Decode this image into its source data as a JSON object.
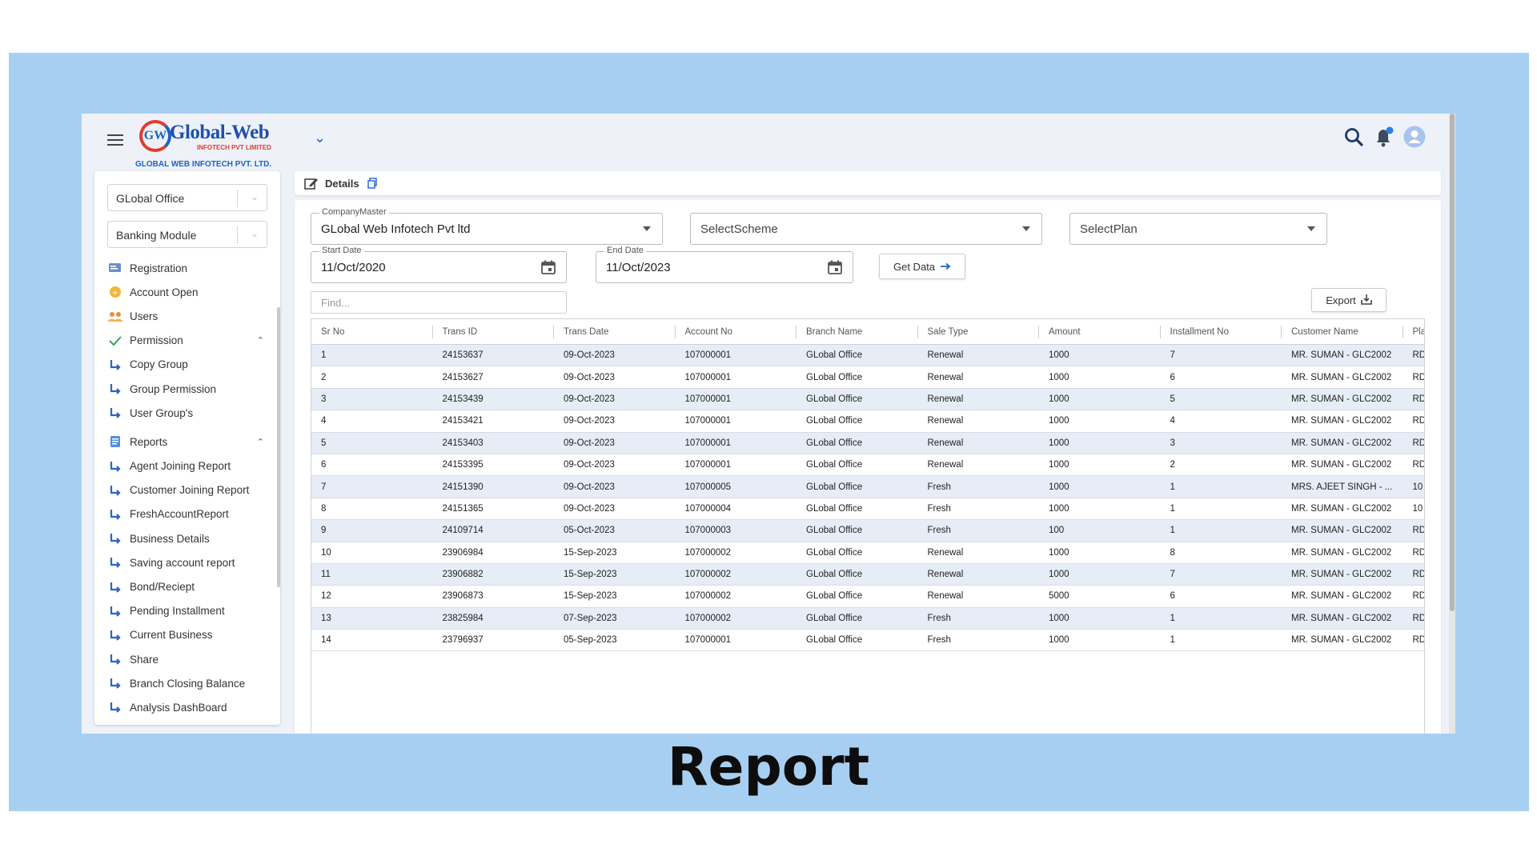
{
  "header": {
    "logo_text": "Global-Web",
    "logo_sub": "INFOTECH PVT LIMITED",
    "logo_tagline": "GLOBAL WEB INFOTECH PVT. LTD.",
    "logo_mark": "GW"
  },
  "sidebar": {
    "branch_select": "GLobal Office",
    "module_select": "Banking Module",
    "items": [
      {
        "label": "Registration"
      },
      {
        "label": "Account Open"
      },
      {
        "label": "Users"
      },
      {
        "label": "Permission"
      },
      {
        "label": "Copy Group"
      },
      {
        "label": "Group Permission"
      },
      {
        "label": "User Group's"
      },
      {
        "label": "Reports"
      },
      {
        "label": "Agent Joining Report"
      },
      {
        "label": "Customer Joining Report"
      },
      {
        "label": "FreshAccountReport"
      },
      {
        "label": "Business Details"
      },
      {
        "label": "Saving account report"
      },
      {
        "label": "Bond/Reciept"
      },
      {
        "label": "Pending Installment"
      },
      {
        "label": "Current Business"
      },
      {
        "label": "Share"
      },
      {
        "label": "Branch Closing Balance"
      },
      {
        "label": "Analysis DashBoard"
      }
    ]
  },
  "details": {
    "title": "Details"
  },
  "filters": {
    "company_label": "CompanyMaster",
    "company_value": "GLobal Web Infotech Pvt ltd",
    "scheme_value": "SelectScheme",
    "plan_value": "SelectPlan",
    "start_label": "Start Date",
    "start_value": "11/Oct/2020",
    "end_label": "End Date",
    "end_value": "11/Oct/2023",
    "get_data_label": "Get Data",
    "find_placeholder": "Find...",
    "export_label": "Export"
  },
  "table": {
    "columns": [
      "Sr No",
      "Trans ID",
      "Trans Date",
      "Account No",
      "Branch Name",
      "Sale Type",
      "Amount",
      "Installment No",
      "Customer Name",
      "Pla"
    ],
    "rows": [
      [
        "1",
        "24153637",
        "09-Oct-2023",
        "107000001",
        "GLobal Office",
        "Renewal",
        "1000",
        "7",
        "MR. SUMAN - GLC2002",
        "RD"
      ],
      [
        "2",
        "24153627",
        "09-Oct-2023",
        "107000001",
        "GLobal Office",
        "Renewal",
        "1000",
        "6",
        "MR. SUMAN - GLC2002",
        "RD"
      ],
      [
        "3",
        "24153439",
        "09-Oct-2023",
        "107000001",
        "GLobal Office",
        "Renewal",
        "1000",
        "5",
        "MR. SUMAN - GLC2002",
        "RD"
      ],
      [
        "4",
        "24153421",
        "09-Oct-2023",
        "107000001",
        "GLobal Office",
        "Renewal",
        "1000",
        "4",
        "MR. SUMAN - GLC2002",
        "RD"
      ],
      [
        "5",
        "24153403",
        "09-Oct-2023",
        "107000001",
        "GLobal Office",
        "Renewal",
        "1000",
        "3",
        "MR. SUMAN - GLC2002",
        "RD"
      ],
      [
        "6",
        "24153395",
        "09-Oct-2023",
        "107000001",
        "GLobal Office",
        "Renewal",
        "1000",
        "2",
        "MR. SUMAN - GLC2002",
        "RD"
      ],
      [
        "7",
        "24151390",
        "09-Oct-2023",
        "107000005",
        "GLobal Office",
        "Fresh",
        "1000",
        "1",
        "MRS. AJEET SINGH - ...",
        "10"
      ],
      [
        "8",
        "24151365",
        "09-Oct-2023",
        "107000004",
        "GLobal Office",
        "Fresh",
        "1000",
        "1",
        "MR. SUMAN - GLC2002",
        "10"
      ],
      [
        "9",
        "24109714",
        "05-Oct-2023",
        "107000003",
        "GLobal Office",
        "Fresh",
        "100",
        "1",
        "MR. SUMAN - GLC2002",
        "RD"
      ],
      [
        "10",
        "23906984",
        "15-Sep-2023",
        "107000002",
        "GLobal Office",
        "Renewal",
        "1000",
        "8",
        "MR. SUMAN - GLC2002",
        "RD"
      ],
      [
        "11",
        "23906882",
        "15-Sep-2023",
        "107000002",
        "GLobal Office",
        "Renewal",
        "1000",
        "7",
        "MR. SUMAN - GLC2002",
        "RD"
      ],
      [
        "12",
        "23906873",
        "15-Sep-2023",
        "107000002",
        "GLobal Office",
        "Renewal",
        "5000",
        "6",
        "MR. SUMAN - GLC2002",
        "RD"
      ],
      [
        "13",
        "23825984",
        "07-Sep-2023",
        "107000002",
        "GLobal Office",
        "Fresh",
        "1000",
        "1",
        "MR. SUMAN - GLC2002",
        "RD"
      ],
      [
        "14",
        "23796937",
        "05-Sep-2023",
        "107000001",
        "GLobal Office",
        "Fresh",
        "1000",
        "1",
        "MR. SUMAN - GLC2002",
        "RD"
      ]
    ]
  },
  "caption": "Report",
  "colors": {
    "slide_bg": "#a7cff2",
    "app_bg": "#eef2f8",
    "brand_blue": "#1e63c4",
    "brand_red": "#e33b2f",
    "row_stripe": "#e6edf7"
  }
}
